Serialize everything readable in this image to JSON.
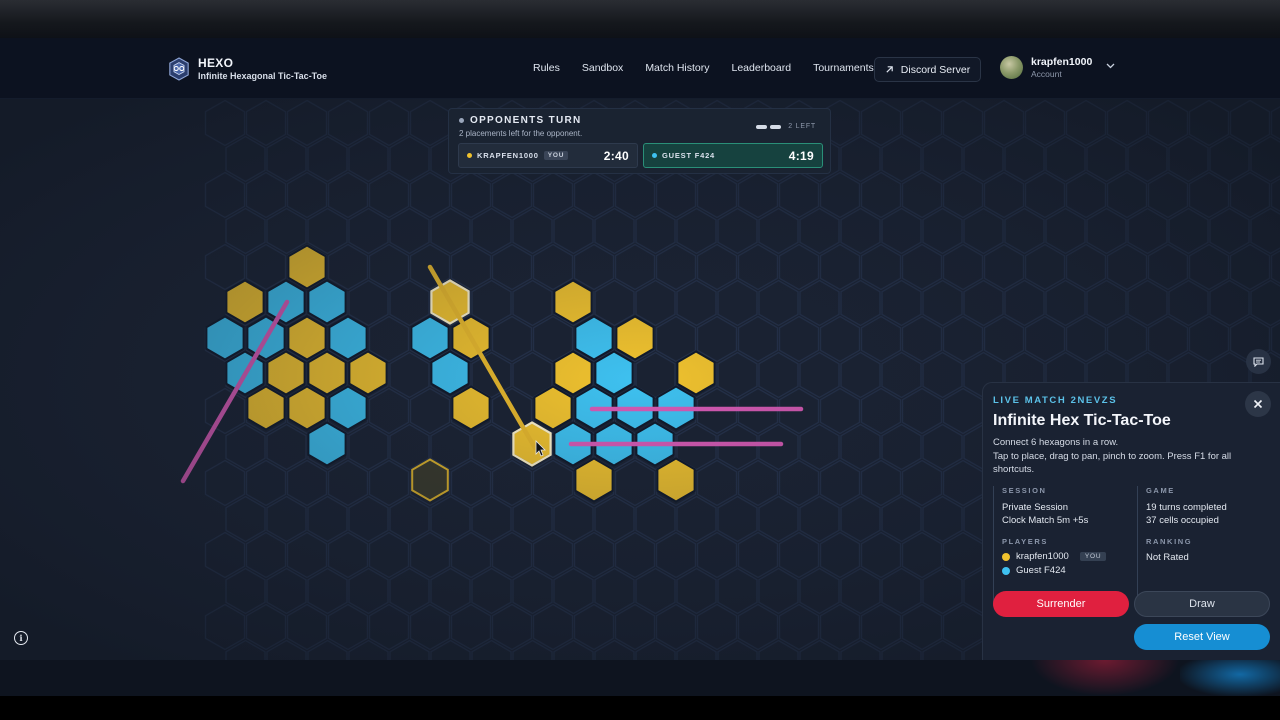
{
  "brand": {
    "title": "HEXO",
    "subtitle": "Infinite Hexagonal Tic-Tac-Toe"
  },
  "nav": {
    "links": [
      "Rules",
      "Sandbox",
      "Match History",
      "Leaderboard",
      "Tournaments"
    ],
    "discord_label": "Discord Server",
    "account_name": "krapfen1000",
    "account_sub": "Account"
  },
  "turn": {
    "title": "OPPONENTS TURN",
    "subtitle": "2 placements left for the opponent.",
    "left_label": "2 LEFT",
    "player1": {
      "name": "KRAPFEN1000",
      "badge": "YOU",
      "time": "2:40",
      "color": "#f0c22e"
    },
    "player2": {
      "name": "GUEST F424",
      "time": "4:19",
      "color": "#3ec1f0"
    }
  },
  "panel": {
    "live": "LIVE MATCH 2NEVZS",
    "title": "Infinite Hex Tic-Tac-Toe",
    "desc1": "Connect 6 hexagons in a row.",
    "desc2": "Tap to place, drag to pan, pinch to zoom. Press F1 for all shortcuts.",
    "session_label": "SESSION",
    "session_v1": "Private Session",
    "session_v2": "Clock Match 5m +5s",
    "game_label": "GAME",
    "game_v1": "19 turns completed",
    "game_v2": "37 cells occupied",
    "players_label": "PLAYERS",
    "p1": "krapfen1000",
    "p1_badge": "YOU",
    "p2": "Guest F424",
    "ranking_label": "RANKING",
    "ranking_v": "Not Rated",
    "surrender": "Surrender",
    "draw": "Draw",
    "reset": "Reset View"
  },
  "colors": {
    "yellow": "#f0c22e",
    "blue": "#3ec1f0",
    "line_pink": "#d75ab4",
    "line_yellow": "#e9b92c",
    "accent_red": "#e0203f",
    "accent_blue": "#168ed3"
  }
}
